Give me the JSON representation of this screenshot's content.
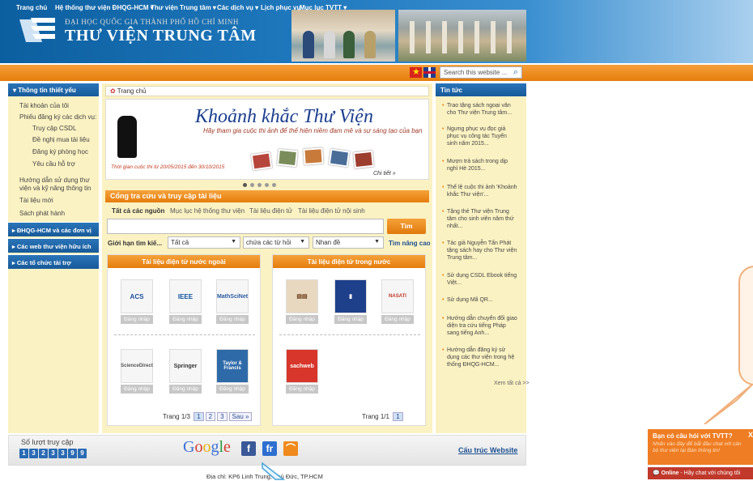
{
  "header": {
    "university": "ĐẠI HỌC QUỐC GIA THÀNH PHỐ HỒ CHÍ MINH",
    "library": "THƯ VIỆN TRUNG TÂM"
  },
  "nav": {
    "items": [
      {
        "label": "Trang chủ"
      },
      {
        "label": "Hệ thống thư viện ĐHQG-HCM"
      },
      {
        "label": "Thư viện Trung tâm"
      },
      {
        "label": "Các dịch vụ"
      },
      {
        "label": "Lịch phục vụ"
      },
      {
        "label": "Mục lục TVTT"
      }
    ],
    "search_placeholder": "Search this website ..."
  },
  "left_sidebar": {
    "title": "Thông tin thiết yếu",
    "items": [
      {
        "label": "Tài khoản của tôi"
      },
      {
        "label": "Phiếu đăng ký các dịch vụ:"
      },
      {
        "label": "Truy cập CSDL"
      },
      {
        "label": "Đề nghị mua tài liệu"
      },
      {
        "label": "Đăng ký phòng học"
      },
      {
        "label": "Yêu cầu hỗ trợ"
      },
      {
        "label": "Hướng dẫn sử dụng thư"
      },
      {
        "label": "viện và kỹ năng thông tin"
      },
      {
        "label": "Tài liệu mới"
      },
      {
        "label": "Sách phát hành"
      }
    ],
    "sections": [
      {
        "label": "ĐHQG-HCM và các đơn vị"
      },
      {
        "label": "Các web thư viện hữu ích"
      },
      {
        "label": "Các tổ chức tài trợ"
      }
    ]
  },
  "breadcrumb": "Trang chủ",
  "banner": {
    "title": "Khoảnh khắc Thư Viện",
    "subtitle": "Hãy tham gia cuộc thi ảnh để thể hiện niềm đam mê và sự sáng tạo của bạn",
    "note": "Thời gian cuộc thi từ 20/05/2015 đến 30/10/2015",
    "action": "Chi tiết »"
  },
  "search_panel": {
    "title": "Cổng tra cứu và truy cập tài liệu",
    "tabs": [
      {
        "label": "Tất cả các nguồn"
      },
      {
        "label": "Mục lục hệ thống thư viện"
      },
      {
        "label": "Tài liệu điện tử"
      },
      {
        "label": "Tài liệu điện tử nội sinh"
      }
    ],
    "query_value": "",
    "button": "Tìm",
    "filter_label": "Giới hạn tìm kiế...",
    "filters": [
      {
        "value": "Tất cả"
      },
      {
        "value": "chứa các từ hỏi"
      },
      {
        "value": "Nhan đề"
      }
    ],
    "advanced": "Tìm nâng cao"
  },
  "external_box": {
    "title": "Tài liệu điện tử nước ngoài",
    "resources": [
      {
        "name": "ACS",
        "button": "Đăng nhập"
      },
      {
        "name": "IEEE",
        "button": "Đăng nhập"
      },
      {
        "name": "MathSciNet",
        "button": "Đăng nhập"
      },
      {
        "name": "ScienceDirect",
        "button": "Đăng nhập"
      },
      {
        "name": "Springer",
        "button": "Đăng nhập"
      },
      {
        "name": "Taylor & Francis Online",
        "button": "Đăng nhập"
      }
    ],
    "pager": {
      "label": "Trang 1/3",
      "pages": [
        "1",
        "2",
        "3"
      ],
      "next": "Sau »"
    }
  },
  "domestic_box": {
    "title": "Tài liệu điện tử trong nước",
    "resources": [
      {
        "name": "Books",
        "button": "Đăng nhập"
      },
      {
        "name": "Journal",
        "button": "Đăng nhập"
      },
      {
        "name": "NASATI",
        "button": "Đăng nhập"
      },
      {
        "name": "sachweb",
        "button": "Đăng nhập"
      }
    ],
    "pager": {
      "label": "Trang 1/1",
      "pages": [
        "1"
      ]
    }
  },
  "news": {
    "title": "Tin tức",
    "items": [
      {
        "lines": [
          "Trao tặng sách ngoại văn",
          "cho Thư viện Trung tâm..."
        ]
      },
      {
        "lines": [
          "Ngưng phục vụ đọc giả",
          "phục vụ công tác Tuyển",
          "sinh năm 2015..."
        ]
      },
      {
        "lines": [
          "Mượn trả sách trong dịp",
          "nghỉ Hè 2015..."
        ]
      },
      {
        "lines": [
          "Thể lệ cuộc thi ảnh 'Khoảnh",
          "khắc Thư viện'..."
        ]
      },
      {
        "lines": [
          "Tặng thẻ Thư viện Trung",
          "tâm cho sinh viên năm thứ",
          "nhất..."
        ]
      },
      {
        "lines": [
          "Tác giả Nguyễn Tấn Phát",
          "tặng sách hay cho Thư viện",
          "Trung tâm..."
        ]
      },
      {
        "lines": [
          "Sử dụng CSDL Ebook tiếng",
          "Việt..."
        ]
      },
      {
        "lines": [
          "Sử dụng Mã QR..."
        ]
      },
      {
        "lines": [
          "Hướng dẫn chuyển đổi giao",
          "diện tra cứu tiếng Pháp",
          "sang tiếng Anh..."
        ]
      },
      {
        "lines": [
          "Hướng dẫn đăng ký sử",
          "dụng các thư viện trong hệ",
          "thống ĐHQG-HCM..."
        ]
      }
    ],
    "more": "Xem tất cả >>"
  },
  "footer": {
    "counter_label": "Số lượt truy cập",
    "counter_digits": [
      "1",
      "3",
      "2",
      "3",
      "3",
      "9",
      "9"
    ],
    "google": "Google",
    "sitemap": "Cấu trúc Website",
    "address": "Địa chỉ: KP6 Linh Trung, Thủ Đức, TP.HCM"
  },
  "chat": {
    "title": "Bạn có câu hỏi với TVTT?",
    "subtitle": "Nhấn vào đây để bắt đầu chat với cán bộ thư viện tại Bàn thông tin!",
    "online": "Online",
    "online_text": " - Hãy chat với chúng tôi",
    "close": "X"
  },
  "colors": {
    "header_blue": "#1f78bd",
    "nav_orange": "#e57d0c",
    "panel_yellow": "#fbf2c3",
    "sidebar_blue": "#175a9a",
    "chat_orange": "#ef7d23"
  }
}
